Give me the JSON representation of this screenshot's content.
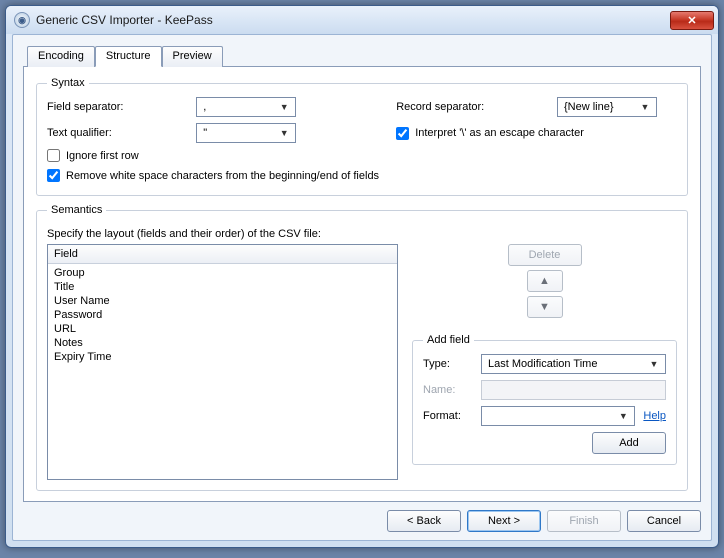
{
  "window": {
    "title": "Generic CSV Importer - KeePass"
  },
  "tabs": {
    "encoding": "Encoding",
    "structure": "Structure",
    "preview": "Preview"
  },
  "syntax": {
    "legend": "Syntax",
    "fieldSeparatorLabel": "Field separator:",
    "fieldSeparatorValue": ",",
    "recordSeparatorLabel": "Record separator:",
    "recordSeparatorValue": "{New line}",
    "textQualifierLabel": "Text qualifier:",
    "textQualifierValue": "\"",
    "interpretEscapeLabel": "Interpret '\\' as an escape character",
    "ignoreFirstRowLabel": "Ignore first row",
    "removeWhitespaceLabel": "Remove white space characters from the beginning/end of fields"
  },
  "semantics": {
    "legend": "Semantics",
    "specify": "Specify the layout (fields and their order) of the CSV file:",
    "columnHeader": "Field",
    "items": [
      "Group",
      "Title",
      "User Name",
      "Password",
      "URL",
      "Notes",
      "Expiry Time"
    ],
    "deleteLabel": "Delete",
    "addField": {
      "legend": "Add field",
      "typeLabel": "Type:",
      "typeValue": "Last Modification Time",
      "nameLabel": "Name:",
      "formatLabel": "Format:",
      "formatValue": "",
      "helpLabel": "Help",
      "addLabel": "Add"
    }
  },
  "footer": {
    "back": "< Back",
    "next": "Next >",
    "finish": "Finish",
    "cancel": "Cancel"
  }
}
